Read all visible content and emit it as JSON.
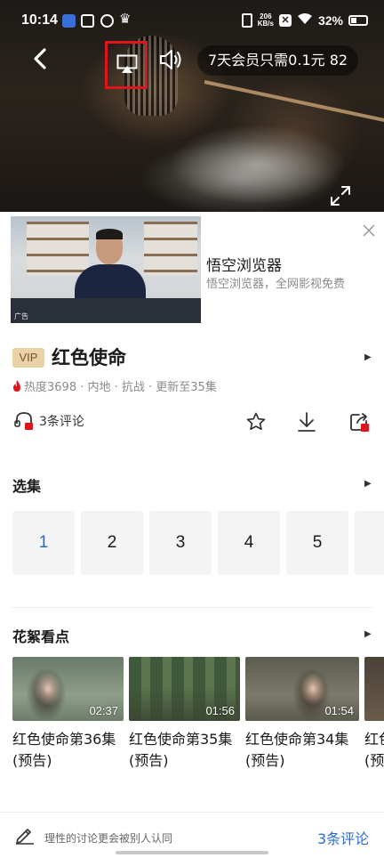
{
  "status_bar": {
    "time": "10:14",
    "net_speed_value": "206",
    "net_speed_unit": "KB/s",
    "battery": "32%"
  },
  "player": {
    "vip_promo": "7天会员只需0.1元 82"
  },
  "ad": {
    "title": "悟空浏览器",
    "description": "悟空浏览器，全网影视免费",
    "tag": "广告"
  },
  "show": {
    "vip_label": "VIP",
    "title": "红色使命",
    "meta": "热度3698 · 内地 · 抗战 · 更新至35集",
    "comments": "3条评论"
  },
  "episodes": {
    "title": "选集",
    "items": [
      "1",
      "2",
      "3",
      "4",
      "5"
    ]
  },
  "clips": {
    "title": "花絮看点",
    "items": [
      {
        "duration": "02:37",
        "line1": "红色使命第36集",
        "line2": "(预告)"
      },
      {
        "duration": "01:56",
        "line1": "红色使命第35集",
        "line2": "(预告)"
      },
      {
        "duration": "01:54",
        "line1": "红色使命第34集",
        "line2": "(预告)"
      },
      {
        "duration": "",
        "line1": "红色",
        "line2": "(预告"
      }
    ]
  },
  "bottom_bar": {
    "hint": "理性的讨论更会被别人认同",
    "comments": "3条评论"
  },
  "colors": {
    "accent_blue": "#2a6dd2",
    "highlight_red": "#e0151c",
    "vip_gold": "#ebd1a6"
  },
  "icons": [
    "back-arrow-icon",
    "cast-icon",
    "volume-icon",
    "fullscreen-icon",
    "close-icon",
    "flame-icon",
    "comment-icon",
    "star-icon",
    "download-icon",
    "share-icon",
    "pencil-icon"
  ]
}
